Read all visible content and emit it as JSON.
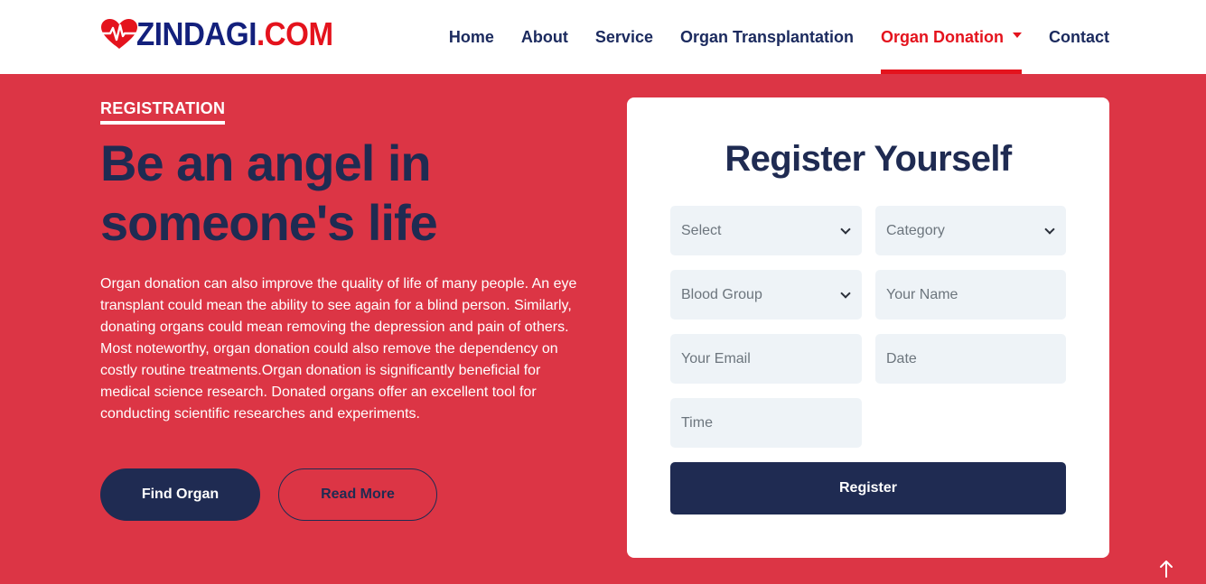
{
  "brand": {
    "name_main": "ZINDAGI",
    "name_suffix": ".COM",
    "colors": {
      "primary_navy": "#1f2b52",
      "logo_navy": "#13207c",
      "accent_red": "#e4131d",
      "hero_bg": "#dc3545",
      "field_bg": "#eef3f7"
    },
    "icon": "heart-pulse-icon"
  },
  "nav": {
    "items": [
      {
        "label": "Home"
      },
      {
        "label": "About"
      },
      {
        "label": "Service"
      },
      {
        "label": "Organ Transplantation"
      },
      {
        "label": "Organ Donation",
        "active": true,
        "dropdown": true
      },
      {
        "label": "Contact"
      }
    ]
  },
  "hero": {
    "tag": "REGISTRATION",
    "headline": "Be an angel in someone's life",
    "description": "Organ donation can also improve the quality of life of many people. An eye transplant could mean the ability to see again for a blind person. Similarly, donating organs could mean removing the depression and pain of others. Most noteworthy, organ donation could also remove the dependency on costly routine treatments.Organ donation is significantly beneficial for medical science research. Donated organs offer an excellent tool for conducting scientific researches and experiments.",
    "buttons": {
      "primary": "Find Organ",
      "secondary": "Read More"
    }
  },
  "form": {
    "title": "Register Yourself",
    "select": {
      "value": "Select"
    },
    "category": {
      "value": "Category"
    },
    "blood_group": {
      "value": "Blood Group"
    },
    "name": {
      "placeholder": "Your Name"
    },
    "email": {
      "placeholder": "Your Email"
    },
    "date": {
      "placeholder": "Date"
    },
    "time": {
      "placeholder": "Time"
    },
    "submit_label": "Register"
  },
  "back_to_top": {
    "icon": "arrow-up-icon"
  }
}
